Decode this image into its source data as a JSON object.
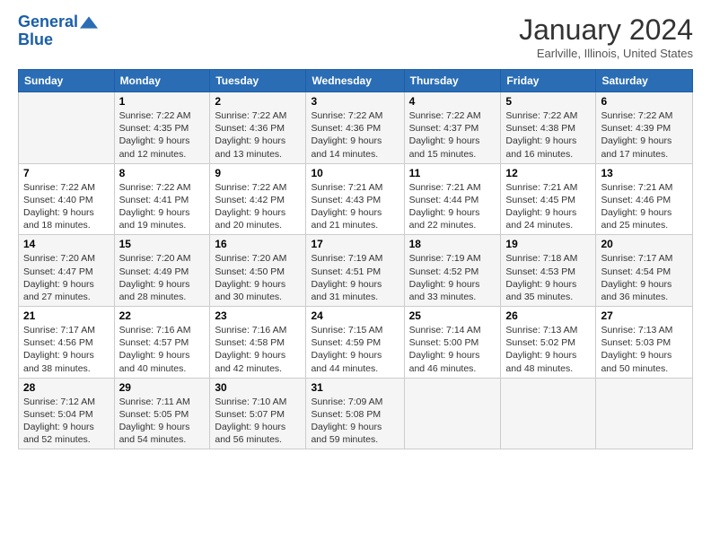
{
  "logo": {
    "line1": "General",
    "line2": "Blue"
  },
  "title": "January 2024",
  "location": "Earlville, Illinois, United States",
  "days": [
    "Sunday",
    "Monday",
    "Tuesday",
    "Wednesday",
    "Thursday",
    "Friday",
    "Saturday"
  ],
  "weeks": [
    [
      {
        "date": "",
        "sunrise": "",
        "sunset": "",
        "daylight": ""
      },
      {
        "date": "1",
        "sunrise": "Sunrise: 7:22 AM",
        "sunset": "Sunset: 4:35 PM",
        "daylight": "Daylight: 9 hours and 12 minutes."
      },
      {
        "date": "2",
        "sunrise": "Sunrise: 7:22 AM",
        "sunset": "Sunset: 4:36 PM",
        "daylight": "Daylight: 9 hours and 13 minutes."
      },
      {
        "date": "3",
        "sunrise": "Sunrise: 7:22 AM",
        "sunset": "Sunset: 4:36 PM",
        "daylight": "Daylight: 9 hours and 14 minutes."
      },
      {
        "date": "4",
        "sunrise": "Sunrise: 7:22 AM",
        "sunset": "Sunset: 4:37 PM",
        "daylight": "Daylight: 9 hours and 15 minutes."
      },
      {
        "date": "5",
        "sunrise": "Sunrise: 7:22 AM",
        "sunset": "Sunset: 4:38 PM",
        "daylight": "Daylight: 9 hours and 16 minutes."
      },
      {
        "date": "6",
        "sunrise": "Sunrise: 7:22 AM",
        "sunset": "Sunset: 4:39 PM",
        "daylight": "Daylight: 9 hours and 17 minutes."
      }
    ],
    [
      {
        "date": "7",
        "sunrise": "Sunrise: 7:22 AM",
        "sunset": "Sunset: 4:40 PM",
        "daylight": "Daylight: 9 hours and 18 minutes."
      },
      {
        "date": "8",
        "sunrise": "Sunrise: 7:22 AM",
        "sunset": "Sunset: 4:41 PM",
        "daylight": "Daylight: 9 hours and 19 minutes."
      },
      {
        "date": "9",
        "sunrise": "Sunrise: 7:22 AM",
        "sunset": "Sunset: 4:42 PM",
        "daylight": "Daylight: 9 hours and 20 minutes."
      },
      {
        "date": "10",
        "sunrise": "Sunrise: 7:21 AM",
        "sunset": "Sunset: 4:43 PM",
        "daylight": "Daylight: 9 hours and 21 minutes."
      },
      {
        "date": "11",
        "sunrise": "Sunrise: 7:21 AM",
        "sunset": "Sunset: 4:44 PM",
        "daylight": "Daylight: 9 hours and 22 minutes."
      },
      {
        "date": "12",
        "sunrise": "Sunrise: 7:21 AM",
        "sunset": "Sunset: 4:45 PM",
        "daylight": "Daylight: 9 hours and 24 minutes."
      },
      {
        "date": "13",
        "sunrise": "Sunrise: 7:21 AM",
        "sunset": "Sunset: 4:46 PM",
        "daylight": "Daylight: 9 hours and 25 minutes."
      }
    ],
    [
      {
        "date": "14",
        "sunrise": "Sunrise: 7:20 AM",
        "sunset": "Sunset: 4:47 PM",
        "daylight": "Daylight: 9 hours and 27 minutes."
      },
      {
        "date": "15",
        "sunrise": "Sunrise: 7:20 AM",
        "sunset": "Sunset: 4:49 PM",
        "daylight": "Daylight: 9 hours and 28 minutes."
      },
      {
        "date": "16",
        "sunrise": "Sunrise: 7:20 AM",
        "sunset": "Sunset: 4:50 PM",
        "daylight": "Daylight: 9 hours and 30 minutes."
      },
      {
        "date": "17",
        "sunrise": "Sunrise: 7:19 AM",
        "sunset": "Sunset: 4:51 PM",
        "daylight": "Daylight: 9 hours and 31 minutes."
      },
      {
        "date": "18",
        "sunrise": "Sunrise: 7:19 AM",
        "sunset": "Sunset: 4:52 PM",
        "daylight": "Daylight: 9 hours and 33 minutes."
      },
      {
        "date": "19",
        "sunrise": "Sunrise: 7:18 AM",
        "sunset": "Sunset: 4:53 PM",
        "daylight": "Daylight: 9 hours and 35 minutes."
      },
      {
        "date": "20",
        "sunrise": "Sunrise: 7:17 AM",
        "sunset": "Sunset: 4:54 PM",
        "daylight": "Daylight: 9 hours and 36 minutes."
      }
    ],
    [
      {
        "date": "21",
        "sunrise": "Sunrise: 7:17 AM",
        "sunset": "Sunset: 4:56 PM",
        "daylight": "Daylight: 9 hours and 38 minutes."
      },
      {
        "date": "22",
        "sunrise": "Sunrise: 7:16 AM",
        "sunset": "Sunset: 4:57 PM",
        "daylight": "Daylight: 9 hours and 40 minutes."
      },
      {
        "date": "23",
        "sunrise": "Sunrise: 7:16 AM",
        "sunset": "Sunset: 4:58 PM",
        "daylight": "Daylight: 9 hours and 42 minutes."
      },
      {
        "date": "24",
        "sunrise": "Sunrise: 7:15 AM",
        "sunset": "Sunset: 4:59 PM",
        "daylight": "Daylight: 9 hours and 44 minutes."
      },
      {
        "date": "25",
        "sunrise": "Sunrise: 7:14 AM",
        "sunset": "Sunset: 5:00 PM",
        "daylight": "Daylight: 9 hours and 46 minutes."
      },
      {
        "date": "26",
        "sunrise": "Sunrise: 7:13 AM",
        "sunset": "Sunset: 5:02 PM",
        "daylight": "Daylight: 9 hours and 48 minutes."
      },
      {
        "date": "27",
        "sunrise": "Sunrise: 7:13 AM",
        "sunset": "Sunset: 5:03 PM",
        "daylight": "Daylight: 9 hours and 50 minutes."
      }
    ],
    [
      {
        "date": "28",
        "sunrise": "Sunrise: 7:12 AM",
        "sunset": "Sunset: 5:04 PM",
        "daylight": "Daylight: 9 hours and 52 minutes."
      },
      {
        "date": "29",
        "sunrise": "Sunrise: 7:11 AM",
        "sunset": "Sunset: 5:05 PM",
        "daylight": "Daylight: 9 hours and 54 minutes."
      },
      {
        "date": "30",
        "sunrise": "Sunrise: 7:10 AM",
        "sunset": "Sunset: 5:07 PM",
        "daylight": "Daylight: 9 hours and 56 minutes."
      },
      {
        "date": "31",
        "sunrise": "Sunrise: 7:09 AM",
        "sunset": "Sunset: 5:08 PM",
        "daylight": "Daylight: 9 hours and 59 minutes."
      },
      {
        "date": "",
        "sunrise": "",
        "sunset": "",
        "daylight": ""
      },
      {
        "date": "",
        "sunrise": "",
        "sunset": "",
        "daylight": ""
      },
      {
        "date": "",
        "sunrise": "",
        "sunset": "",
        "daylight": ""
      }
    ]
  ]
}
